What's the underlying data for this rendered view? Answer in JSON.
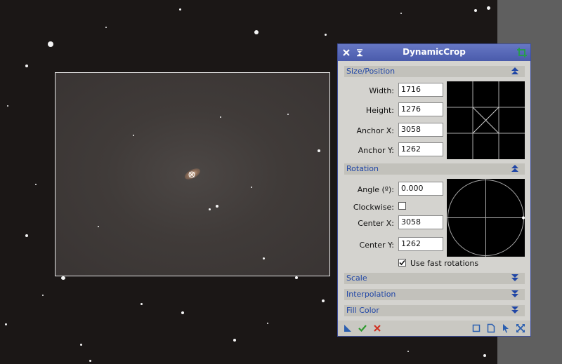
{
  "window": {
    "title": "DynamicCrop"
  },
  "sections": {
    "size_position": {
      "label": "Size/Position"
    },
    "rotation": {
      "label": "Rotation"
    },
    "scale": {
      "label": "Scale"
    },
    "interpolation": {
      "label": "Interpolation"
    },
    "fill_color": {
      "label": "Fill Color"
    }
  },
  "size_position": {
    "width_label": "Width:",
    "width_value": "1716",
    "height_label": "Height:",
    "height_value": "1276",
    "anchor_x_label": "Anchor X:",
    "anchor_x_value": "3058",
    "anchor_y_label": "Anchor Y:",
    "anchor_y_value": "1262"
  },
  "rotation": {
    "angle_label": "Angle (º):",
    "angle_value": "0.000",
    "clockwise_label": "Clockwise:",
    "clockwise_checked": false,
    "center_x_label": "Center X:",
    "center_x_value": "3058",
    "center_y_label": "Center Y:",
    "center_y_value": "1262",
    "fast_rotations_label": "Use fast rotations",
    "fast_rotations_checked": true
  },
  "icons": {
    "close": "close-icon",
    "shade": "shade-icon",
    "crop": "crop-icon",
    "new_instance": "new-instance-icon",
    "execute": "check-icon",
    "cancel": "cancel-icon",
    "preview": "square-icon",
    "document": "document-icon",
    "pointer": "pointer-icon",
    "reset": "reset-icon",
    "expand": "double-arrow-down-icon",
    "collapse": "double-arrow-up-icon"
  },
  "colors": {
    "titlebar": "#5566b8",
    "section_text": "#2046a6",
    "execute_green": "#2e9a2e",
    "cancel_red": "#d03020",
    "crop_green": "#23a045"
  }
}
